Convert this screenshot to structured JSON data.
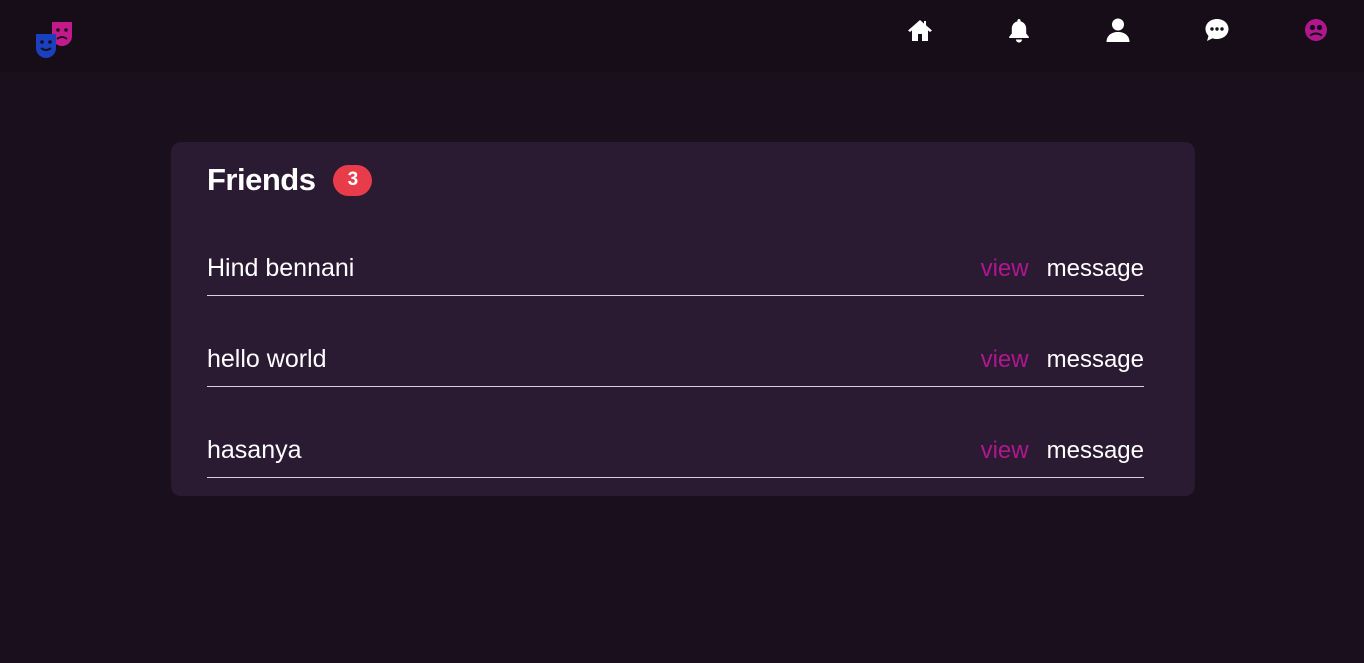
{
  "nav": {
    "icons": [
      "mask-logo-icon",
      "home-icon",
      "bell-icon",
      "user-icon",
      "chat-icon",
      "profile-icon"
    ],
    "accent_color": "#b0178f",
    "logo_colors": [
      "#1a3fbf",
      "#c21a8a"
    ]
  },
  "friends": {
    "title": "Friends",
    "count": "3",
    "badge_color": "#e83c4a",
    "items": [
      {
        "name": "Hind bennani",
        "view_label": "view",
        "message_label": "message"
      },
      {
        "name": "hello world",
        "view_label": "view",
        "message_label": "message"
      },
      {
        "name": "hasanya",
        "view_label": "view",
        "message_label": "message"
      }
    ]
  }
}
